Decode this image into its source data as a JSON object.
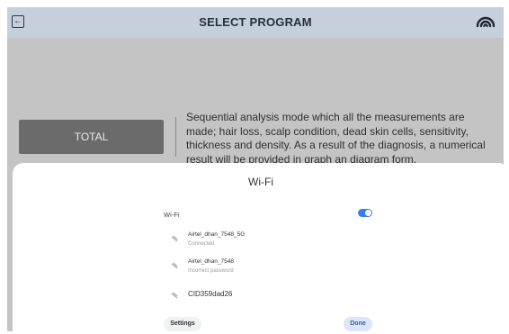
{
  "header": {
    "title": "SELECT PROGRAM",
    "back_icon": "←",
    "signal_icon": "signal-waves-icon"
  },
  "program": {
    "total_label": "TOTAL",
    "description": "Sequential analysis mode which all the measurements are made; hair loss, scalp condition, dead skin cells, sensitivity, thickness and density. As a result of the diagnosis, a numerical result will be provided in graph an diagram form."
  },
  "wifi_sheet": {
    "title": "Wi-Fi",
    "wifi_label": "Wi-Fi",
    "wifi_enabled": true,
    "networks": [
      {
        "name": "Airtel_dhan_7548_5G",
        "status": "Connected"
      },
      {
        "name": "Airtel_dhan_7548",
        "status": "Incorrect password"
      },
      {
        "name": "CID359dad26",
        "status": ""
      }
    ],
    "settings_label": "Settings",
    "done_label": "Done"
  },
  "colors": {
    "header_bg": "#c6cfdc",
    "app_bg": "#c4c4c4",
    "total_button": "#6b6b6b",
    "toggle_on": "#3b7cf0",
    "done_button_bg": "#dbe6f8"
  }
}
